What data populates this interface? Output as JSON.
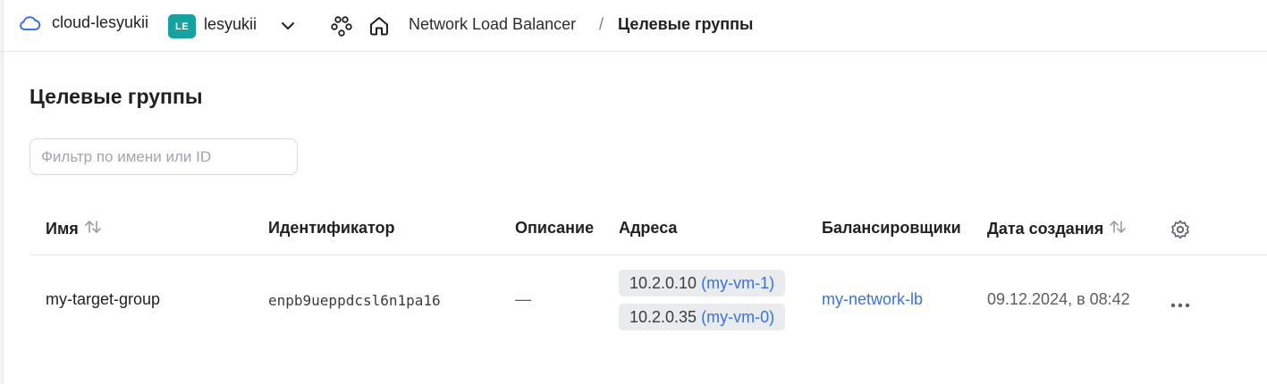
{
  "header": {
    "cloud_name": "cloud-lesyukii",
    "folder_badge": "LE",
    "folder_name": "lesyukii",
    "breadcrumbs": [
      "Network Load Balancer",
      "Целевые группы"
    ],
    "breadcrumb_separator": "/"
  },
  "page": {
    "title": "Целевые группы",
    "filter_placeholder": "Фильтр по имени или ID",
    "filter_value": ""
  },
  "table": {
    "columns": [
      "Имя",
      "Идентификатор",
      "Описание",
      "Адреса",
      "Балансировщики",
      "Дата создания"
    ],
    "rows": [
      {
        "name": "my-target-group",
        "id": "enpb9ueppdcsl6n1pa16",
        "description": "—",
        "addresses": [
          {
            "ip": "10.2.0.10",
            "vm": "(my-vm-1)"
          },
          {
            "ip": "10.2.0.35",
            "vm": "(my-vm-0)"
          }
        ],
        "balancer": "my-network-lb",
        "created": "09.12.2024, в 08:42"
      }
    ]
  },
  "icons": {
    "cloud": "cloud-icon",
    "chevron": "chevron-down-icon",
    "services": "services-icon",
    "home": "home-icon",
    "sort": "sort-icon",
    "settings": "gear-icon",
    "more": "more-icon"
  },
  "colors": {
    "folder_badge": "#17a19f",
    "link": "#3a73d6",
    "chip_bg": "#e9ebee"
  }
}
